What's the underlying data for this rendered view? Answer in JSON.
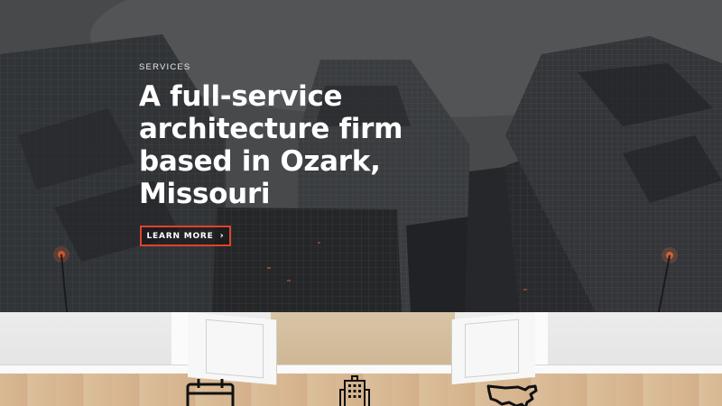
{
  "hero": {
    "eyebrow": "SERVICES",
    "title": "A full-service architecture firm based in Ozark, Missouri",
    "button_label": "LEARN MORE",
    "button_icon": "chevron-right-icon",
    "accent_color": "#e2412b"
  },
  "features": {
    "icons": [
      "calendar-icon",
      "office-building-icon",
      "usa-map-icon"
    ]
  }
}
